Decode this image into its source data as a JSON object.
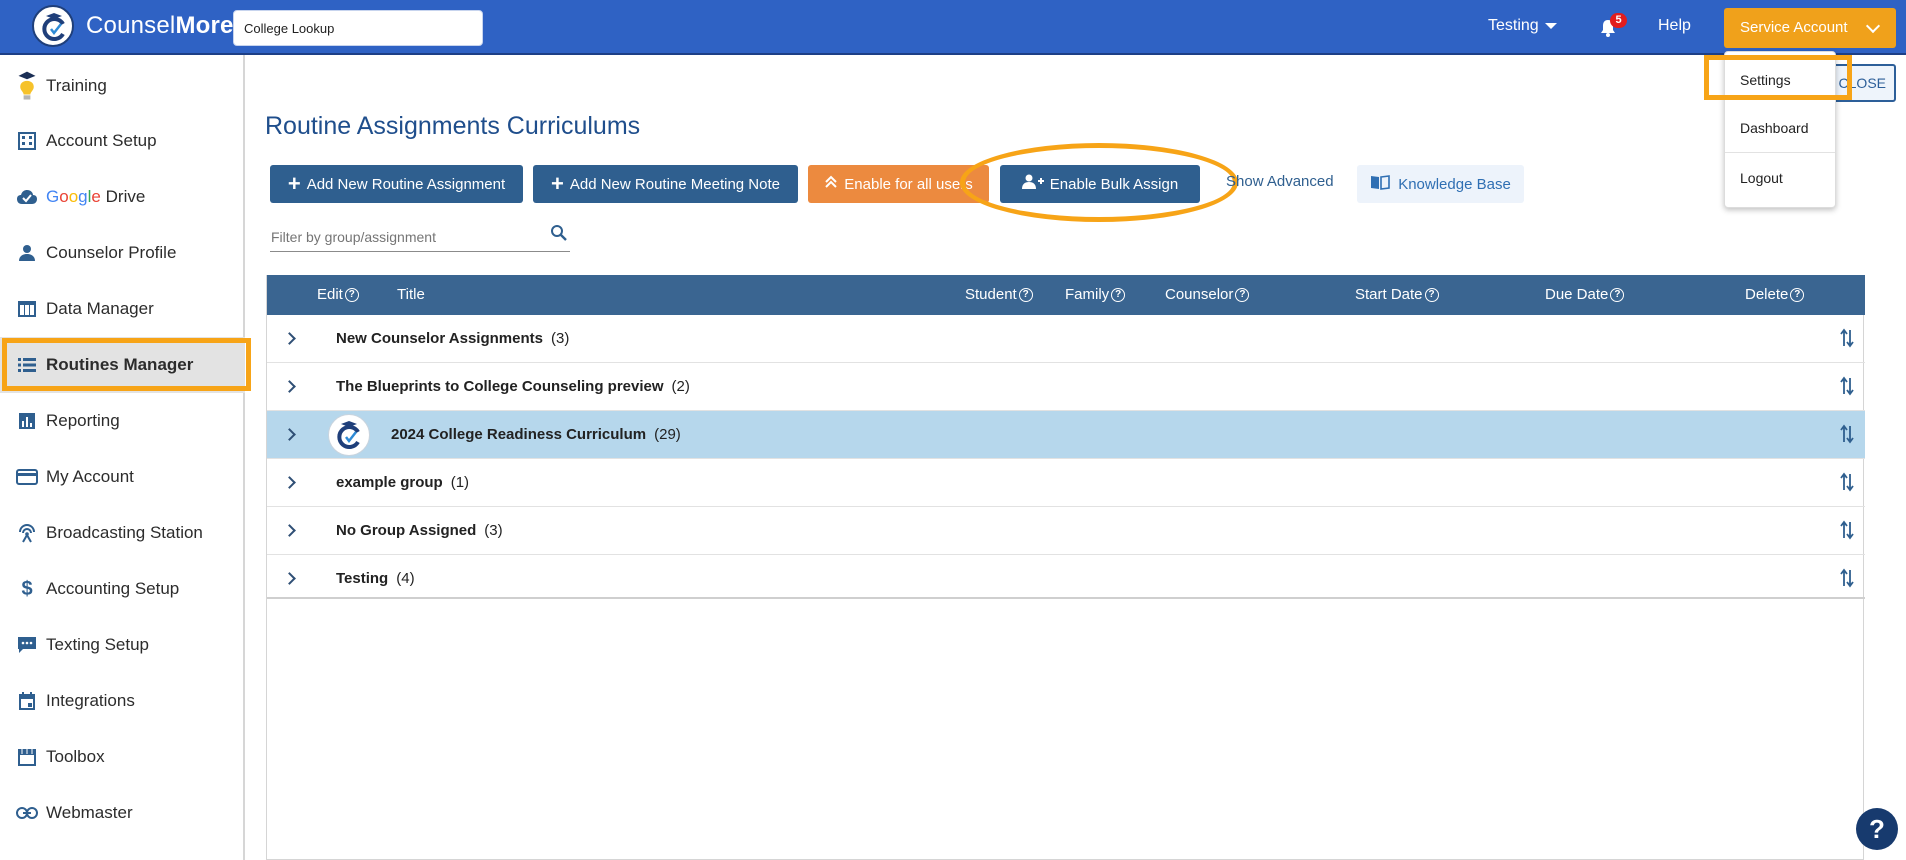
{
  "brand": {
    "name_light": "Counsel",
    "name_bold": "More"
  },
  "topbar": {
    "search_value": "College Lookup",
    "school_selector": "Testing",
    "notification_count": "5",
    "help_label": "Help",
    "account_label": "Service Account"
  },
  "account_menu": {
    "items": [
      "Settings",
      "Dashboard",
      "Logout"
    ]
  },
  "sidebar": {
    "items": [
      {
        "label": "Training"
      },
      {
        "label": "Account Setup"
      },
      {
        "label": "Drive",
        "prefix_letters": [
          "G",
          "o",
          "o",
          "g",
          "l",
          "e"
        ]
      },
      {
        "label": "Counselor Profile"
      },
      {
        "label": "Data Manager"
      },
      {
        "label": "Routines Manager"
      },
      {
        "label": "Reporting"
      },
      {
        "label": "My Account"
      },
      {
        "label": "Broadcasting Station"
      },
      {
        "label": "Accounting Setup"
      },
      {
        "label": "Texting Setup"
      },
      {
        "label": "Integrations"
      },
      {
        "label": "Toolbox"
      },
      {
        "label": "Webmaster"
      }
    ],
    "active_item": "Routines Manager"
  },
  "main": {
    "close_label": "CLOSE",
    "page_title": "Routine Assignments Curriculums",
    "buttons": {
      "add_assignment": "Add New Routine Assignment",
      "add_meeting_note": "Add New Routine Meeting Note",
      "enable_all_users": "Enable for all users",
      "enable_bulk_assign": "Enable Bulk Assign",
      "show_advanced": "Show Advanced",
      "knowledge_base": "Knowledge Base"
    },
    "filter_placeholder": "Filter by group/assignment",
    "table": {
      "columns": [
        "Edit",
        "Title",
        "Student",
        "Family",
        "Counselor",
        "Start Date",
        "Due Date",
        "Delete"
      ],
      "rows": [
        {
          "title": "New Counselor Assignments",
          "count": "(3)"
        },
        {
          "title": "The Blueprints to College Counseling preview",
          "count": "(2)"
        },
        {
          "title": "2024 College Readiness Curriculum",
          "count": "(29)",
          "selected": true
        },
        {
          "title": "example group",
          "count": "(1)"
        },
        {
          "title": "No Group Assigned",
          "count": "(3)"
        },
        {
          "title": "Testing",
          "count": "(4)"
        }
      ]
    },
    "help_bubble": "?"
  },
  "colors": {
    "topbar": "#2f62c4",
    "account_button": "#f0a11b",
    "primary_button": "#2f5f8f",
    "orange_button": "#ec8a3f",
    "table_header": "#3a6591",
    "selected_row": "#b6d7ec",
    "highlight": "#f7a417"
  }
}
